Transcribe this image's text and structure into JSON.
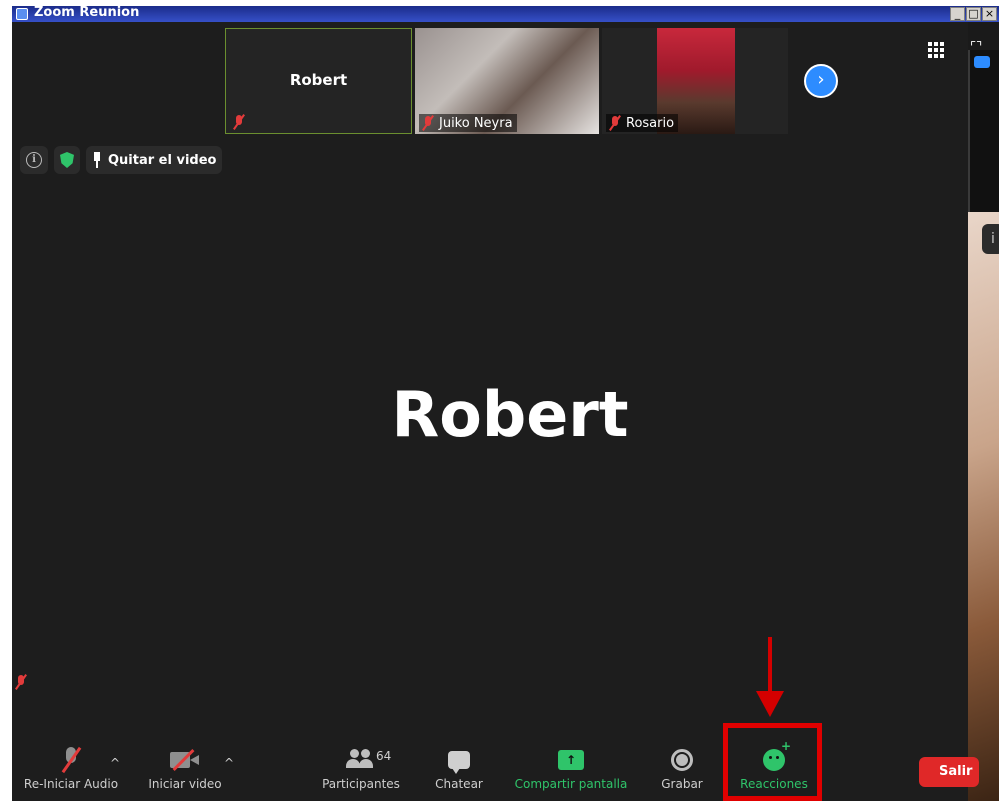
{
  "window": {
    "title": "Zoom Reunion",
    "controls": [
      "_",
      "□",
      "×"
    ]
  },
  "thumbnails": [
    {
      "name": "Robert",
      "has_video": false,
      "muted": true
    },
    {
      "name": "Juiko Neyra",
      "has_video": true,
      "muted": true
    },
    {
      "name": "Rosario",
      "has_video": true,
      "muted": true
    }
  ],
  "top_bar": {
    "info_icon": "info-icon",
    "security_icon": "shield-icon",
    "unpin_label": "Quitar el video"
  },
  "active_speaker": {
    "name": "Robert"
  },
  "toolbar": {
    "audio_label": "Re-Iniciar Audio",
    "video_label": "Iniciar video",
    "participants_label": "Participantes",
    "participants_count": "64",
    "chat_label": "Chatear",
    "share_label": "Compartir pantalla",
    "record_label": "Grabar",
    "reactions_label": "Reacciones",
    "leave_label": "Salir"
  },
  "colors": {
    "accent": "#2d8cff",
    "share_green": "#2fc46a",
    "mute_red": "#e23b3b",
    "highlight_red": "#e00000",
    "leave_red": "#e02828",
    "background": "#1d1d1d"
  }
}
